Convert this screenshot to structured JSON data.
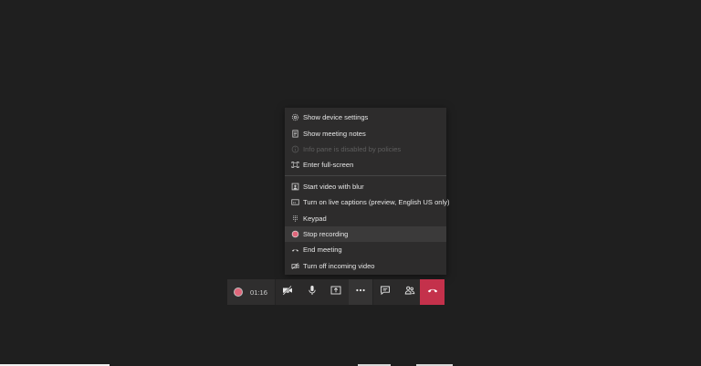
{
  "menu": {
    "items": [
      {
        "label": "Show device settings",
        "icon": "gear-icon",
        "disabled": false
      },
      {
        "label": "Show meeting notes",
        "icon": "notes-icon",
        "disabled": false
      },
      {
        "label": "Info pane is disabled by policies",
        "icon": "info-icon",
        "disabled": true
      },
      {
        "label": "Enter full-screen",
        "icon": "fullscreen-icon",
        "disabled": false
      },
      {
        "label": "Start video with blur",
        "icon": "blur-icon",
        "disabled": false
      },
      {
        "label": "Turn on live captions (preview, English US only)",
        "icon": "captions-icon",
        "disabled": false
      },
      {
        "label": "Keypad",
        "icon": "keypad-icon",
        "disabled": false
      },
      {
        "label": "Stop recording",
        "icon": "record-icon",
        "disabled": false,
        "highlighted": true
      },
      {
        "label": "End meeting",
        "icon": "end-call-icon",
        "disabled": false
      },
      {
        "label": "Turn off incoming video",
        "icon": "video-off-icon",
        "disabled": false
      }
    ]
  },
  "toolbar": {
    "timer": "01:16",
    "recording_color": "#e0667a",
    "hangup_color": "#c4314b",
    "buttons": [
      "camera-off-icon",
      "microphone-icon",
      "share-screen-icon",
      "more-options-icon",
      "chat-icon",
      "participants-icon",
      "hang-up-icon"
    ]
  }
}
